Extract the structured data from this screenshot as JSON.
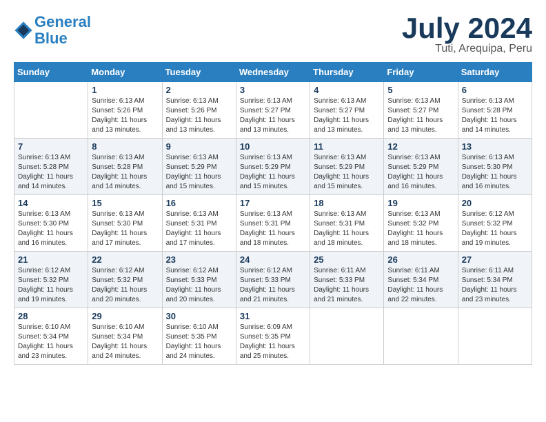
{
  "header": {
    "logo_line1": "General",
    "logo_line2": "Blue",
    "title": "July 2024",
    "location": "Tuti, Arequipa, Peru"
  },
  "calendar": {
    "weekdays": [
      "Sunday",
      "Monday",
      "Tuesday",
      "Wednesday",
      "Thursday",
      "Friday",
      "Saturday"
    ],
    "weeks": [
      [
        {
          "day": "",
          "sunrise": "",
          "sunset": "",
          "daylight": ""
        },
        {
          "day": "1",
          "sunrise": "Sunrise: 6:13 AM",
          "sunset": "Sunset: 5:26 PM",
          "daylight": "Daylight: 11 hours and 13 minutes."
        },
        {
          "day": "2",
          "sunrise": "Sunrise: 6:13 AM",
          "sunset": "Sunset: 5:26 PM",
          "daylight": "Daylight: 11 hours and 13 minutes."
        },
        {
          "day": "3",
          "sunrise": "Sunrise: 6:13 AM",
          "sunset": "Sunset: 5:27 PM",
          "daylight": "Daylight: 11 hours and 13 minutes."
        },
        {
          "day": "4",
          "sunrise": "Sunrise: 6:13 AM",
          "sunset": "Sunset: 5:27 PM",
          "daylight": "Daylight: 11 hours and 13 minutes."
        },
        {
          "day": "5",
          "sunrise": "Sunrise: 6:13 AM",
          "sunset": "Sunset: 5:27 PM",
          "daylight": "Daylight: 11 hours and 13 minutes."
        },
        {
          "day": "6",
          "sunrise": "Sunrise: 6:13 AM",
          "sunset": "Sunset: 5:28 PM",
          "daylight": "Daylight: 11 hours and 14 minutes."
        }
      ],
      [
        {
          "day": "7",
          "sunrise": "Sunrise: 6:13 AM",
          "sunset": "Sunset: 5:28 PM",
          "daylight": "Daylight: 11 hours and 14 minutes."
        },
        {
          "day": "8",
          "sunrise": "Sunrise: 6:13 AM",
          "sunset": "Sunset: 5:28 PM",
          "daylight": "Daylight: 11 hours and 14 minutes."
        },
        {
          "day": "9",
          "sunrise": "Sunrise: 6:13 AM",
          "sunset": "Sunset: 5:29 PM",
          "daylight": "Daylight: 11 hours and 15 minutes."
        },
        {
          "day": "10",
          "sunrise": "Sunrise: 6:13 AM",
          "sunset": "Sunset: 5:29 PM",
          "daylight": "Daylight: 11 hours and 15 minutes."
        },
        {
          "day": "11",
          "sunrise": "Sunrise: 6:13 AM",
          "sunset": "Sunset: 5:29 PM",
          "daylight": "Daylight: 11 hours and 15 minutes."
        },
        {
          "day": "12",
          "sunrise": "Sunrise: 6:13 AM",
          "sunset": "Sunset: 5:29 PM",
          "daylight": "Daylight: 11 hours and 16 minutes."
        },
        {
          "day": "13",
          "sunrise": "Sunrise: 6:13 AM",
          "sunset": "Sunset: 5:30 PM",
          "daylight": "Daylight: 11 hours and 16 minutes."
        }
      ],
      [
        {
          "day": "14",
          "sunrise": "Sunrise: 6:13 AM",
          "sunset": "Sunset: 5:30 PM",
          "daylight": "Daylight: 11 hours and 16 minutes."
        },
        {
          "day": "15",
          "sunrise": "Sunrise: 6:13 AM",
          "sunset": "Sunset: 5:30 PM",
          "daylight": "Daylight: 11 hours and 17 minutes."
        },
        {
          "day": "16",
          "sunrise": "Sunrise: 6:13 AM",
          "sunset": "Sunset: 5:31 PM",
          "daylight": "Daylight: 11 hours and 17 minutes."
        },
        {
          "day": "17",
          "sunrise": "Sunrise: 6:13 AM",
          "sunset": "Sunset: 5:31 PM",
          "daylight": "Daylight: 11 hours and 18 minutes."
        },
        {
          "day": "18",
          "sunrise": "Sunrise: 6:13 AM",
          "sunset": "Sunset: 5:31 PM",
          "daylight": "Daylight: 11 hours and 18 minutes."
        },
        {
          "day": "19",
          "sunrise": "Sunrise: 6:13 AM",
          "sunset": "Sunset: 5:32 PM",
          "daylight": "Daylight: 11 hours and 18 minutes."
        },
        {
          "day": "20",
          "sunrise": "Sunrise: 6:12 AM",
          "sunset": "Sunset: 5:32 PM",
          "daylight": "Daylight: 11 hours and 19 minutes."
        }
      ],
      [
        {
          "day": "21",
          "sunrise": "Sunrise: 6:12 AM",
          "sunset": "Sunset: 5:32 PM",
          "daylight": "Daylight: 11 hours and 19 minutes."
        },
        {
          "day": "22",
          "sunrise": "Sunrise: 6:12 AM",
          "sunset": "Sunset: 5:32 PM",
          "daylight": "Daylight: 11 hours and 20 minutes."
        },
        {
          "day": "23",
          "sunrise": "Sunrise: 6:12 AM",
          "sunset": "Sunset: 5:33 PM",
          "daylight": "Daylight: 11 hours and 20 minutes."
        },
        {
          "day": "24",
          "sunrise": "Sunrise: 6:12 AM",
          "sunset": "Sunset: 5:33 PM",
          "daylight": "Daylight: 11 hours and 21 minutes."
        },
        {
          "day": "25",
          "sunrise": "Sunrise: 6:11 AM",
          "sunset": "Sunset: 5:33 PM",
          "daylight": "Daylight: 11 hours and 21 minutes."
        },
        {
          "day": "26",
          "sunrise": "Sunrise: 6:11 AM",
          "sunset": "Sunset: 5:34 PM",
          "daylight": "Daylight: 11 hours and 22 minutes."
        },
        {
          "day": "27",
          "sunrise": "Sunrise: 6:11 AM",
          "sunset": "Sunset: 5:34 PM",
          "daylight": "Daylight: 11 hours and 23 minutes."
        }
      ],
      [
        {
          "day": "28",
          "sunrise": "Sunrise: 6:10 AM",
          "sunset": "Sunset: 5:34 PM",
          "daylight": "Daylight: 11 hours and 23 minutes."
        },
        {
          "day": "29",
          "sunrise": "Sunrise: 6:10 AM",
          "sunset": "Sunset: 5:34 PM",
          "daylight": "Daylight: 11 hours and 24 minutes."
        },
        {
          "day": "30",
          "sunrise": "Sunrise: 6:10 AM",
          "sunset": "Sunset: 5:35 PM",
          "daylight": "Daylight: 11 hours and 24 minutes."
        },
        {
          "day": "31",
          "sunrise": "Sunrise: 6:09 AM",
          "sunset": "Sunset: 5:35 PM",
          "daylight": "Daylight: 11 hours and 25 minutes."
        },
        {
          "day": "",
          "sunrise": "",
          "sunset": "",
          "daylight": ""
        },
        {
          "day": "",
          "sunrise": "",
          "sunset": "",
          "daylight": ""
        },
        {
          "day": "",
          "sunrise": "",
          "sunset": "",
          "daylight": ""
        }
      ]
    ]
  }
}
